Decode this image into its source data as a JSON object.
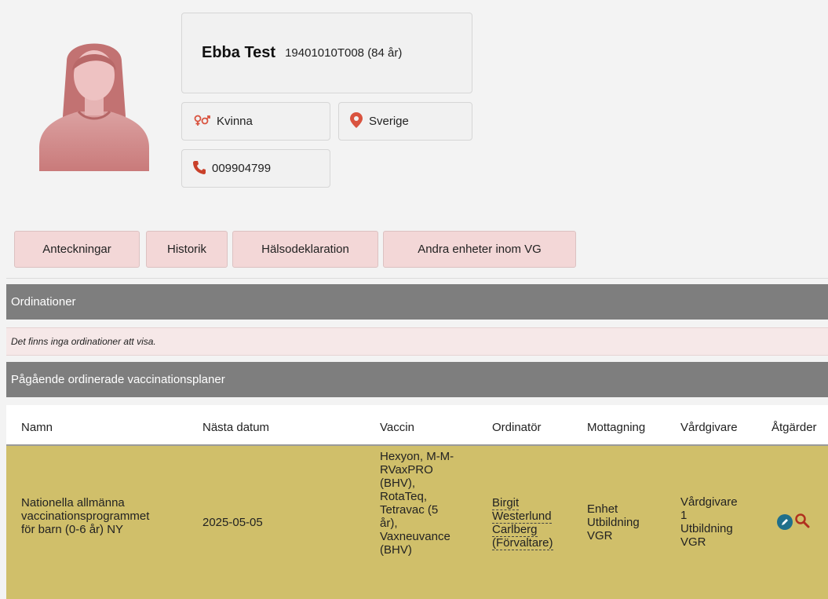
{
  "patient": {
    "name": "Ebba Test",
    "personnummer": "19401010T008 (84 år)",
    "gender": "Kvinna",
    "country": "Sverige",
    "phone": "009904799"
  },
  "tabs": [
    {
      "label": "Anteckningar"
    },
    {
      "label": "Historik"
    },
    {
      "label": "Hälsodeklaration"
    },
    {
      "label": "Andra enheter inom VG"
    }
  ],
  "ordinations": {
    "title": "Ordinationer",
    "empty_text": "Det finns inga ordinationer att visa."
  },
  "plans": {
    "title": "Pågående ordinerade vaccinationsplaner",
    "columns": [
      "Namn",
      "Nästa datum",
      "Vaccin",
      "Ordinatör",
      "Mottagning",
      "Vårdgivare",
      "Åtgärder"
    ],
    "rows": [
      {
        "namn": [
          "Nationella allmänna",
          "vaccinationsprogrammet",
          "för barn (0-6 år) NY"
        ],
        "nasta_datum": "2025-05-05",
        "vaccin": [
          "Hexyon, M-M-",
          "RVaxPRO",
          "(BHV),",
          "RotaTeq,",
          "Tetravac (5",
          "år),",
          "Vaxneuvance",
          "(BHV)"
        ],
        "ordinator": [
          "Birgit",
          "Westerlund",
          "Carlberg",
          "(Förvaltare)"
        ],
        "mottagning": [
          "Enhet",
          "Utbildning",
          "VGR"
        ],
        "vardgivare": [
          "Vårdgivare",
          "1",
          "Utbildning",
          "VGR"
        ]
      }
    ]
  },
  "colors": {
    "tab_bg": "#f3d7d7",
    "section_header": "#7e7e7e",
    "row_highlight": "#d0bf6a",
    "gender_icon": "#d9533f",
    "location_icon": "#d9533f",
    "phone_icon": "#c9402a",
    "edit_icon": "#1f6f8b",
    "search_icon": "#b0301e"
  },
  "icons": {
    "gender": "gender-female-male-icon",
    "country": "map-pin-icon",
    "phone": "phone-icon",
    "edit": "pencil-icon",
    "view": "magnifier-icon"
  }
}
